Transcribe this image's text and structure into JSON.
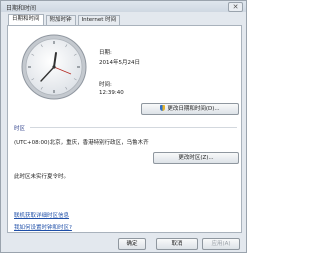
{
  "window": {
    "title": "日期和时间",
    "close_glyph": "✕"
  },
  "tabs": [
    {
      "label": "日期和时间"
    },
    {
      "label": "附加时钟"
    },
    {
      "label": "Internet 时间"
    }
  ],
  "date": {
    "label": "日期:",
    "value": "2014年5月24日"
  },
  "time": {
    "label": "时间:",
    "value": "12:39:40"
  },
  "buttons": {
    "change_datetime": "更改日期和时间(D)...",
    "change_timezone": "更改时区(Z)...",
    "ok": "确定",
    "cancel": "取消",
    "apply": "应用(A)"
  },
  "timezone": {
    "heading": "时区",
    "value": "(UTC+08:00)北京，重庆，香港特别行政区，乌鲁木齐",
    "dst_note": "此时区未实行夏令时。"
  },
  "links": [
    "联机获取详细时区信息",
    "我如何设置时钟和时区?"
  ],
  "colors": {
    "link": "#1f4fa8",
    "heading": "#2d3f8a"
  }
}
